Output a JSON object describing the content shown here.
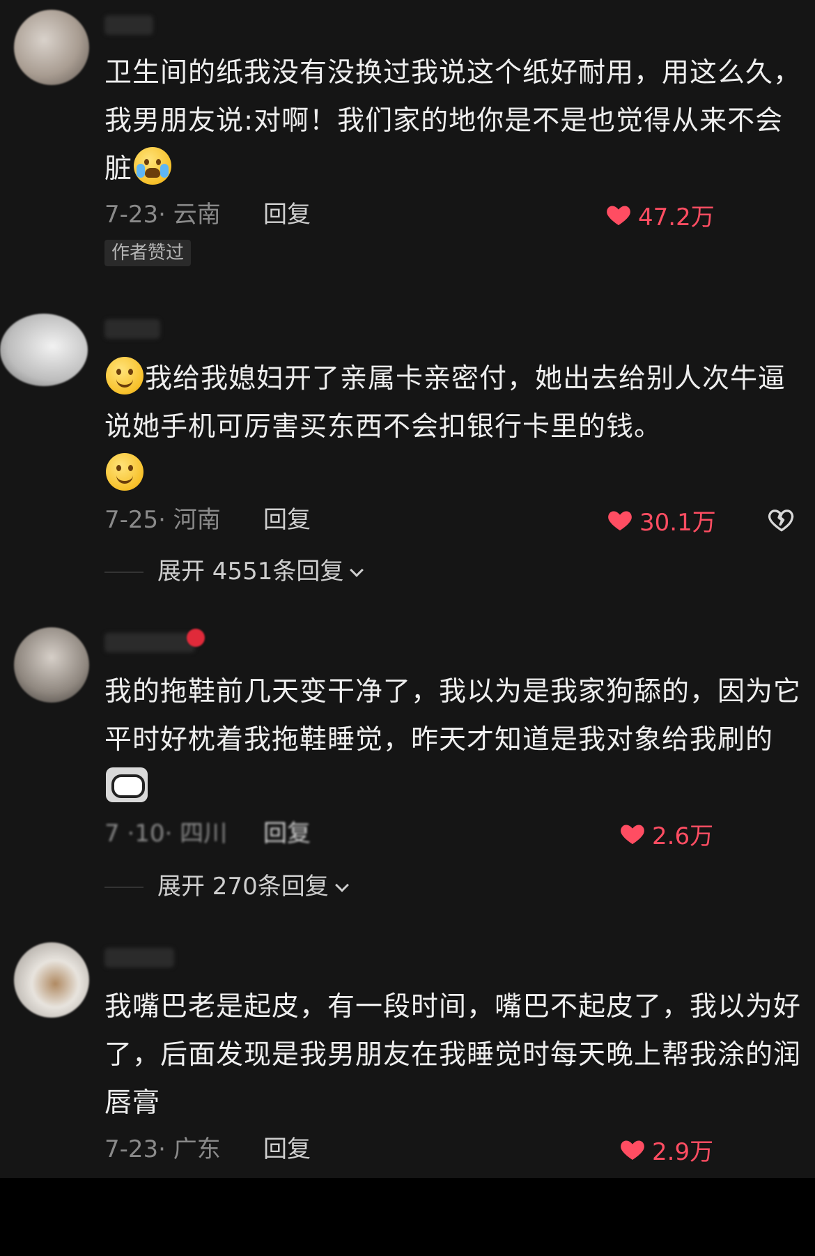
{
  "comments": [
    {
      "text_a": "卫生间的纸我没有没换过我说这个纸好耐用，用这么久，我男朋友说:对啊！我们家的地你是不是也觉得从来不会脏",
      "date": "7-23· 云南",
      "reply": "回复",
      "likes": "47.2万",
      "badge": "作者赞过"
    },
    {
      "text_a": "我给我媳妇开了亲属卡亲密付，她出去给别人次牛逼说她手机可厉害买东西不会扣银行卡里的钱。",
      "date": "7-25· 河南",
      "reply": "回复",
      "likes": "30.1万",
      "expand": "展开 4551条回复"
    },
    {
      "text_a": "我的拖鞋前几天变干净了，我以为是我家狗舔的，因为它平时好枕着我拖鞋睡觉，昨天才知道是我对象给我刷的",
      "date": "7 ·10· 四川",
      "reply": "回复",
      "likes": "2.6万",
      "expand": "展开 270条回复"
    },
    {
      "text_a": "我嘴巴老是起皮，有一段时间，嘴巴不起皮了，我以为好了，后面发现是我男朋友在我睡觉时每天晚上帮我涂的润唇膏",
      "date": "7-23· 广东",
      "reply": "回复",
      "likes": "2.9万"
    }
  ],
  "colors": {
    "background": "#151515",
    "like": "#ff4d62",
    "text": "#eeeeee",
    "meta": "#8a8a8a"
  },
  "icons": {
    "heart": "heart-icon",
    "dislike": "broken-heart-icon",
    "emoji_cry": "crying-emoji",
    "emoji_smile": "smile-emoji",
    "emoji_grimace": "grimace-emoji"
  }
}
